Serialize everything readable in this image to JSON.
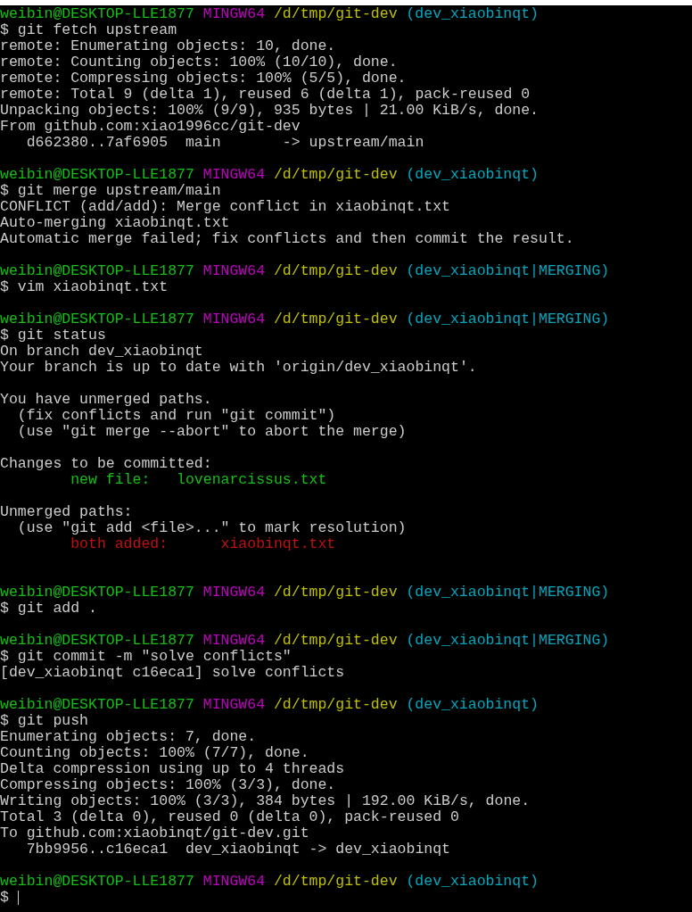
{
  "terminal": {
    "lines": [
      {
        "kind": "prompt",
        "user": "weibin@DESKTOP-LLE1877",
        "system": "MINGW64",
        "path": "/d/tmp/git-dev",
        "branch": "(dev_xiaobinqt)"
      },
      {
        "kind": "command",
        "text": "$ git fetch upstream"
      },
      {
        "kind": "output",
        "text": "remote: Enumerating objects: 10, done."
      },
      {
        "kind": "output",
        "text": "remote: Counting objects: 100% (10/10), done."
      },
      {
        "kind": "output",
        "text": "remote: Compressing objects: 100% (5/5), done."
      },
      {
        "kind": "output",
        "text": "remote: Total 9 (delta 1), reused 6 (delta 1), pack-reused 0"
      },
      {
        "kind": "output",
        "text": "Unpacking objects: 100% (9/9), 935 bytes | 21.00 KiB/s, done."
      },
      {
        "kind": "output",
        "text": "From github.com:xiao1996cc/git-dev"
      },
      {
        "kind": "output",
        "text": "   d662380..7af6905  main       -> upstream/main"
      },
      {
        "kind": "blank"
      },
      {
        "kind": "prompt",
        "user": "weibin@DESKTOP-LLE1877",
        "system": "MINGW64",
        "path": "/d/tmp/git-dev",
        "branch": "(dev_xiaobinqt)"
      },
      {
        "kind": "command",
        "text": "$ git merge upstream/main"
      },
      {
        "kind": "output",
        "text": "CONFLICT (add/add): Merge conflict in xiaobinqt.txt"
      },
      {
        "kind": "output",
        "text": "Auto-merging xiaobinqt.txt"
      },
      {
        "kind": "output",
        "text": "Automatic merge failed; fix conflicts and then commit the result."
      },
      {
        "kind": "blank"
      },
      {
        "kind": "prompt",
        "user": "weibin@DESKTOP-LLE1877",
        "system": "MINGW64",
        "path": "/d/tmp/git-dev",
        "branch": "(dev_xiaobinqt|MERGING)"
      },
      {
        "kind": "command",
        "text": "$ vim xiaobinqt.txt"
      },
      {
        "kind": "blank"
      },
      {
        "kind": "prompt",
        "user": "weibin@DESKTOP-LLE1877",
        "system": "MINGW64",
        "path": "/d/tmp/git-dev",
        "branch": "(dev_xiaobinqt|MERGING)"
      },
      {
        "kind": "command",
        "text": "$ git status"
      },
      {
        "kind": "output",
        "text": "On branch dev_xiaobinqt"
      },
      {
        "kind": "output",
        "text": "Your branch is up to date with 'origin/dev_xiaobinqt'."
      },
      {
        "kind": "blank"
      },
      {
        "kind": "output",
        "text": "You have unmerged paths."
      },
      {
        "kind": "output",
        "text": "  (fix conflicts and run \"git commit\")"
      },
      {
        "kind": "output",
        "text": "  (use \"git merge --abort\" to abort the merge)"
      },
      {
        "kind": "blank"
      },
      {
        "kind": "output",
        "text": "Changes to be committed:"
      },
      {
        "kind": "staged",
        "text": "new file:   lovenarcissus.txt"
      },
      {
        "kind": "blank"
      },
      {
        "kind": "output",
        "text": "Unmerged paths:"
      },
      {
        "kind": "output",
        "text": "  (use \"git add <file>...\" to mark resolution)"
      },
      {
        "kind": "unmerged",
        "text": "both added:      xiaobinqt.txt"
      },
      {
        "kind": "blank"
      },
      {
        "kind": "blank"
      },
      {
        "kind": "prompt",
        "user": "weibin@DESKTOP-LLE1877",
        "system": "MINGW64",
        "path": "/d/tmp/git-dev",
        "branch": "(dev_xiaobinqt|MERGING)"
      },
      {
        "kind": "command",
        "text": "$ git add ."
      },
      {
        "kind": "blank"
      },
      {
        "kind": "prompt",
        "user": "weibin@DESKTOP-LLE1877",
        "system": "MINGW64",
        "path": "/d/tmp/git-dev",
        "branch": "(dev_xiaobinqt|MERGING)"
      },
      {
        "kind": "command",
        "text": "$ git commit -m \"solve conflicts\""
      },
      {
        "kind": "output",
        "text": "[dev_xiaobinqt c16eca1] solve conflicts"
      },
      {
        "kind": "blank"
      },
      {
        "kind": "prompt",
        "user": "weibin@DESKTOP-LLE1877",
        "system": "MINGW64",
        "path": "/d/tmp/git-dev",
        "branch": "(dev_xiaobinqt)"
      },
      {
        "kind": "command",
        "text": "$ git push"
      },
      {
        "kind": "output",
        "text": "Enumerating objects: 7, done."
      },
      {
        "kind": "output",
        "text": "Counting objects: 100% (7/7), done."
      },
      {
        "kind": "output",
        "text": "Delta compression using up to 4 threads"
      },
      {
        "kind": "output",
        "text": "Compressing objects: 100% (3/3), done."
      },
      {
        "kind": "output",
        "text": "Writing objects: 100% (3/3), 384 bytes | 192.00 KiB/s, done."
      },
      {
        "kind": "output",
        "text": "Total 3 (delta 0), reused 0 (delta 0), pack-reused 0"
      },
      {
        "kind": "output",
        "text": "To github.com:xiaobinqt/git-dev.git"
      },
      {
        "kind": "output",
        "text": "   7bb9956..c16eca1  dev_xiaobinqt -> dev_xiaobinqt"
      },
      {
        "kind": "blank"
      },
      {
        "kind": "prompt",
        "user": "weibin@DESKTOP-LLE1877",
        "system": "MINGW64",
        "path": "/d/tmp/git-dev",
        "branch": "(dev_xiaobinqt)"
      },
      {
        "kind": "input",
        "text": "$"
      }
    ]
  }
}
